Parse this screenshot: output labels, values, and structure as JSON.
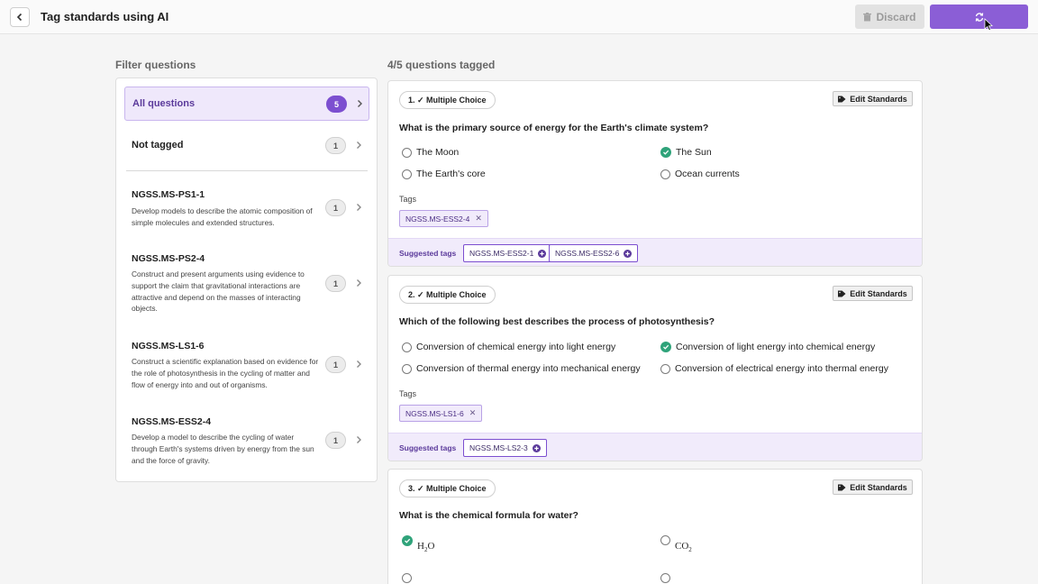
{
  "header": {
    "title": "Tag standards using AI",
    "discard_label": "Discard"
  },
  "filter": {
    "heading": "Filter questions",
    "all": {
      "label": "All questions",
      "count": "5"
    },
    "not_tagged": {
      "label": "Not tagged",
      "count": "1"
    },
    "standards": [
      {
        "code": "NGSS.MS-PS1-1",
        "desc": "Develop models to describe the atomic composition of simple molecules and extended structures.",
        "count": "1"
      },
      {
        "code": "NGSS.MS-PS2-4",
        "desc": "Construct and present arguments using evidence to support the claim that gravitational interactions are attractive and depend on the masses of interacting objects.",
        "count": "1"
      },
      {
        "code": "NGSS.MS-LS1-6",
        "desc": "Construct a scientific explanation based on evidence for the role of photosynthesis in the cycling of matter and flow of energy into and out of organisms.",
        "count": "1"
      },
      {
        "code": "NGSS.MS-ESS2-4",
        "desc": "Develop a model to describe the cycling of water through Earth's systems driven by energy from the sun and the force of gravity.",
        "count": "1"
      }
    ]
  },
  "questions_heading": "4/5 questions tagged",
  "questions": [
    {
      "type_label": "1. ✓ Multiple Choice",
      "edit_label": "Edit Standards",
      "text": "What is the primary source of energy for the Earth's climate system?",
      "options": [
        "The Moon",
        "The Sun",
        "The Earth's core",
        "Ocean currents"
      ],
      "tags_label": "Tags",
      "tags": [
        "NGSS.MS-ESS2-4"
      ],
      "suggested_label": "Suggested tags",
      "suggested": [
        "NGSS.MS-ESS2-1",
        "NGSS.MS-ESS2-6"
      ]
    },
    {
      "type_label": "2. ✓ Multiple Choice",
      "edit_label": "Edit Standards",
      "text": "Which of the following best describes the process of photosynthesis?",
      "options": [
        "Conversion of chemical energy into light energy",
        "Conversion of light energy into chemical energy",
        "Conversion of thermal energy into mechanical energy",
        "Conversion of electrical energy into thermal energy"
      ],
      "tags_label": "Tags",
      "tags": [
        "NGSS.MS-LS1-6"
      ],
      "suggested_label": "Suggested tags",
      "suggested": [
        "NGSS.MS-LS2-3"
      ]
    },
    {
      "type_label": "3. ✓ Multiple Choice",
      "edit_label": "Edit Standards",
      "text": "What is the chemical formula for water?",
      "options": [
        "H",
        "2",
        "O",
        "CO",
        "2"
      ]
    }
  ],
  "colors": {
    "accent": "#8b5ed6",
    "correct": "#2fa37a",
    "tag_bg": "#f1ebfb"
  },
  "icons": [
    "chevron-left-icon",
    "trash-icon",
    "refresh-icon",
    "cursor-icon",
    "chevron-right-icon",
    "tag-icon",
    "check-icon",
    "close-icon",
    "plus-circle-icon"
  ]
}
